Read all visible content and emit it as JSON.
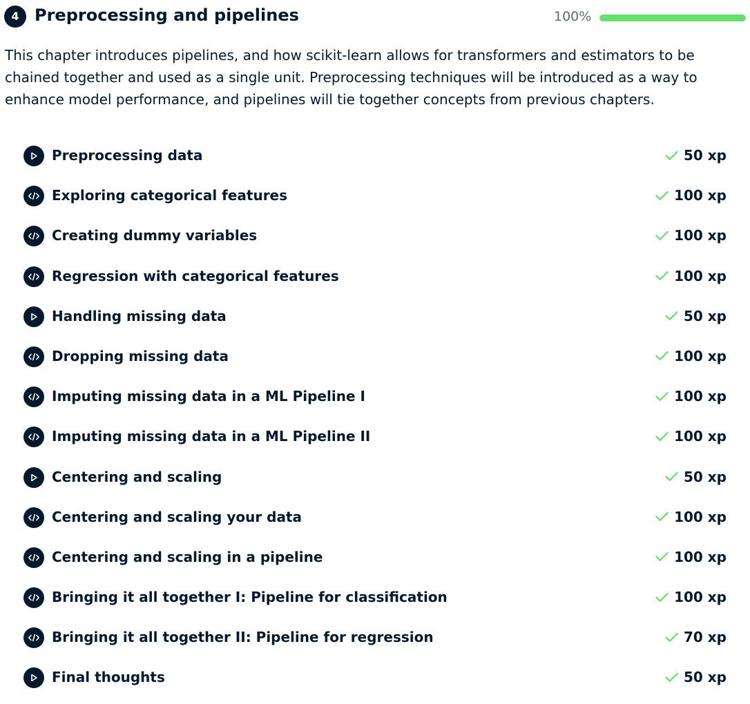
{
  "chapter": {
    "number": "4",
    "title": "Preprocessing and pipelines",
    "progress_label": "100%",
    "progress_fraction": 1.0,
    "description": "This chapter introduces pipelines, and how scikit-learn allows for transformers and estimators to be chained together and used as a single unit. Preprocessing techniques will be introduced as a way to enhance model performance, and pipelines will tie together concepts from previous chapters."
  },
  "colors": {
    "navy": "#05192d",
    "progress_green": "#65e06c",
    "check_green": "#65e06c",
    "muted_text": "#5d6a77"
  },
  "lessons": [
    {
      "title": "Preprocessing data",
      "xp": "50 xp",
      "type": "video",
      "icon": "play-icon",
      "completed": true
    },
    {
      "title": "Exploring categorical features",
      "xp": "100 xp",
      "type": "exercise",
      "icon": "code-icon",
      "completed": true
    },
    {
      "title": "Creating dummy variables",
      "xp": "100 xp",
      "type": "exercise",
      "icon": "code-icon",
      "completed": true
    },
    {
      "title": "Regression with categorical features",
      "xp": "100 xp",
      "type": "exercise",
      "icon": "code-icon",
      "completed": true
    },
    {
      "title": "Handling missing data",
      "xp": "50 xp",
      "type": "video",
      "icon": "play-icon",
      "completed": true
    },
    {
      "title": "Dropping missing data",
      "xp": "100 xp",
      "type": "exercise",
      "icon": "code-icon",
      "completed": true
    },
    {
      "title": "Imputing missing data in a ML Pipeline I",
      "xp": "100 xp",
      "type": "exercise",
      "icon": "code-icon",
      "completed": true
    },
    {
      "title": "Imputing missing data in a ML Pipeline II",
      "xp": "100 xp",
      "type": "exercise",
      "icon": "code-icon",
      "completed": true
    },
    {
      "title": "Centering and scaling",
      "xp": "50 xp",
      "type": "video",
      "icon": "play-icon",
      "completed": true
    },
    {
      "title": "Centering and scaling your data",
      "xp": "100 xp",
      "type": "exercise",
      "icon": "code-icon",
      "completed": true
    },
    {
      "title": "Centering and scaling in a pipeline",
      "xp": "100 xp",
      "type": "exercise",
      "icon": "code-icon",
      "completed": true
    },
    {
      "title": "Bringing it all together I: Pipeline for classification",
      "xp": "100 xp",
      "type": "exercise",
      "icon": "code-icon",
      "completed": true
    },
    {
      "title": "Bringing it all together II: Pipeline for regression",
      "xp": "70 xp",
      "type": "exercise",
      "icon": "code-icon",
      "completed": true
    },
    {
      "title": "Final thoughts",
      "xp": "50 xp",
      "type": "video",
      "icon": "play-icon",
      "completed": true
    }
  ]
}
